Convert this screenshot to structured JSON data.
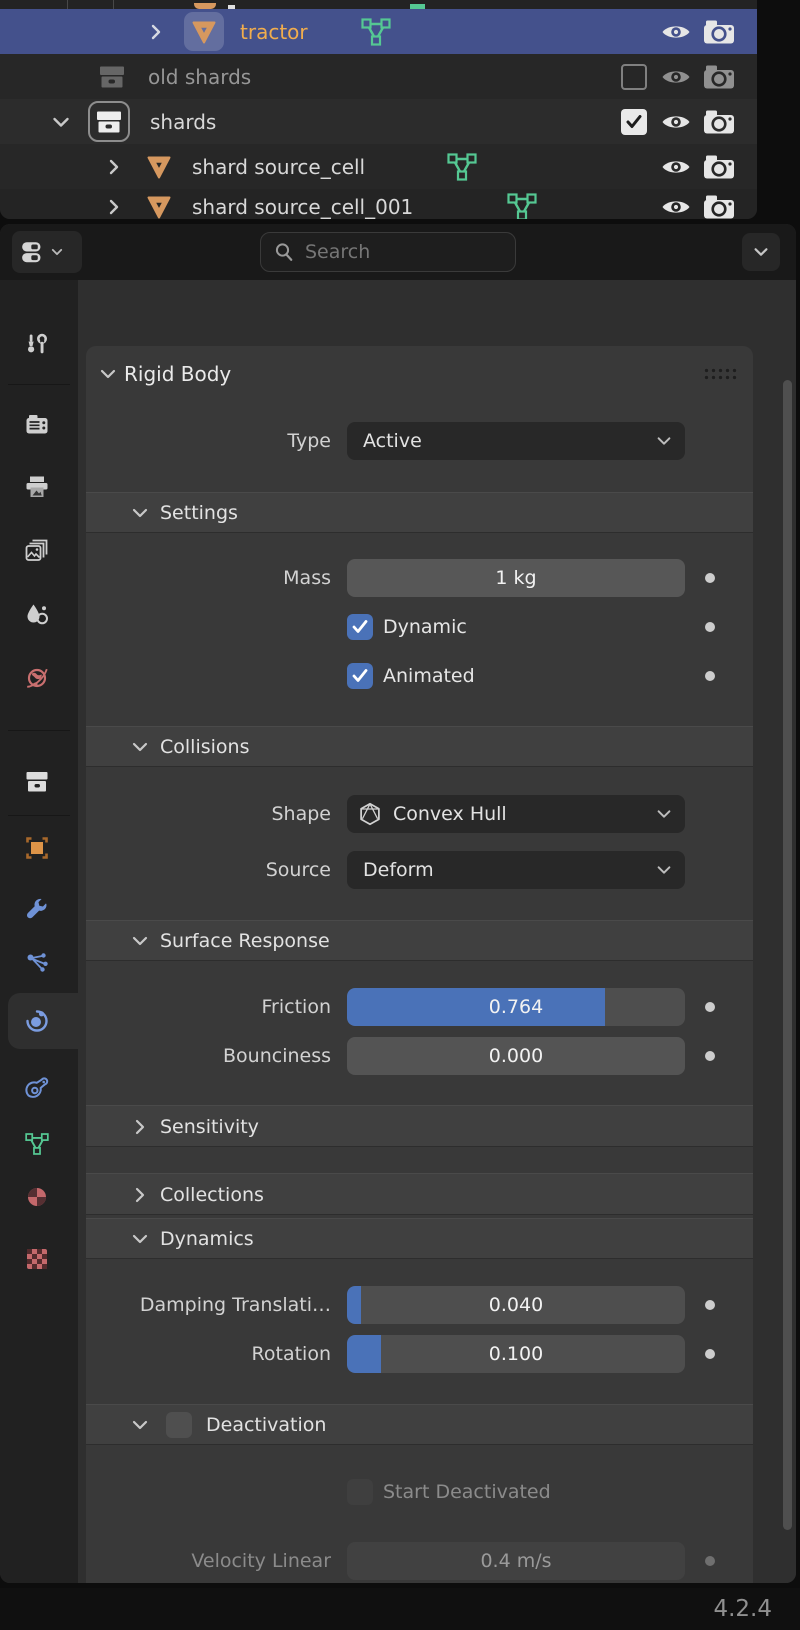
{
  "outliner": {
    "rows": [
      {
        "label": "tractor",
        "state": "selected-active"
      },
      {
        "label": "old shards",
        "state": "dimmed-excluded"
      },
      {
        "label": "shards",
        "state": "active-collection"
      },
      {
        "label": "shard source_cell",
        "state": "normal"
      },
      {
        "label": "shard source_cell_001",
        "state": "normal"
      }
    ]
  },
  "header": {
    "search_placeholder": "Search"
  },
  "tabs": {
    "items": [
      "tool",
      "render",
      "output",
      "view-layer",
      "scene",
      "world",
      "collection",
      "object",
      "modifiers",
      "particles",
      "physics",
      "constraints",
      "object-data",
      "material",
      "texture"
    ],
    "active": "physics"
  },
  "panel": {
    "title": "Rigid Body",
    "type": {
      "label": "Type",
      "value": "Active"
    },
    "settings": {
      "title": "Settings",
      "mass_label": "Mass",
      "mass_value": "1 kg",
      "dynamic_label": "Dynamic",
      "animated_label": "Animated"
    },
    "collisions": {
      "title": "Collisions",
      "shape_label": "Shape",
      "shape_value": "Convex Hull",
      "source_label": "Source",
      "source_value": "Deform"
    },
    "surface": {
      "title": "Surface Response",
      "friction_label": "Friction",
      "friction_value": "0.764",
      "friction_pct": 76.4,
      "bounciness_label": "Bounciness",
      "bounciness_value": "0.000",
      "bounciness_pct": 0
    },
    "sensitivity": {
      "title": "Sensitivity"
    },
    "collections": {
      "title": "Collections"
    },
    "dynamics": {
      "title": "Dynamics",
      "damping_label": "Damping Translati…",
      "damping_value": "0.040",
      "damping_pct": 4,
      "rotation_label": "Rotation",
      "rotation_value": "0.100",
      "rotation_pct": 10
    },
    "deactivation": {
      "title": "Deactivation",
      "start_label": "Start Deactivated",
      "velocity_label": "Velocity Linear",
      "velocity_value": "0.4 m/s"
    }
  },
  "status": {
    "version": "4.2.4"
  },
  "colors": {
    "accent_blue": "#4a72b8",
    "selection_blue": "#44518c",
    "object_orange": "#d6985f",
    "mesh_green": "#55c893",
    "world_red": "#c96f6f"
  }
}
